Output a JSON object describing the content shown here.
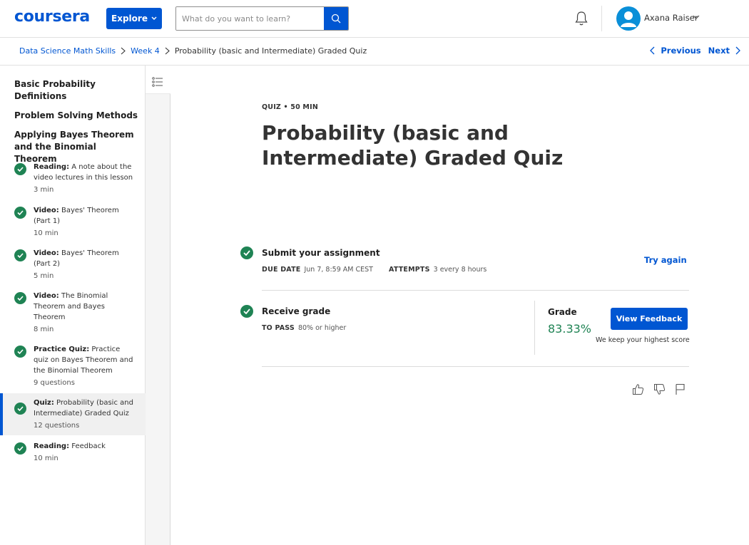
{
  "header": {
    "logo": "coursera",
    "explore_label": "Explore",
    "search_placeholder": "What do you want to learn?",
    "user_name": "Axana Raiser"
  },
  "breadcrumb": {
    "items": [
      "Data Science Math Skills",
      "Week 4",
      "Probability (basic and Intermediate) Graded Quiz"
    ],
    "previous_label": "Previous",
    "next_label": "Next"
  },
  "sidebar": {
    "sections": [
      "Basic Probability Definitions",
      "Problem Solving Methods",
      "Applying Bayes Theorem and the Binomial Theorem"
    ],
    "items": [
      {
        "type": "Reading:",
        "title": " A note about the video lectures in this lesson",
        "meta": "3 min"
      },
      {
        "type": "Video:",
        "title": " Bayes' Theorem (Part 1)",
        "meta": "10 min"
      },
      {
        "type": "Video:",
        "title": " Bayes' Theorem (Part 2)",
        "meta": "5 min"
      },
      {
        "type": "Video:",
        "title": " The Binomial Theorem and Bayes Theorem",
        "meta": "8 min"
      },
      {
        "type": "Practice Quiz:",
        "title": " Practice quiz on Bayes Theorem and the Binomial Theorem",
        "meta": "9 questions"
      },
      {
        "type": "Quiz:",
        "title": " Probability (basic and Intermediate) Graded Quiz",
        "meta": "12 questions"
      },
      {
        "type": "Reading:",
        "title": " Feedback",
        "meta": "10 min"
      }
    ]
  },
  "main": {
    "kicker": "QUIZ • 50 MIN",
    "title": "Probability (basic and Intermediate) Graded Quiz",
    "submit": {
      "title": "Submit your assignment",
      "due_label": "DUE DATE",
      "due_value": "Jun 7, 8:59 AM CEST",
      "attempts_label": "ATTEMPTS",
      "attempts_value": "3 every 8 hours",
      "try_again": "Try again"
    },
    "grade": {
      "title": "Receive grade",
      "pass_label": "TO PASS",
      "pass_value": "80% or higher",
      "grade_label": "Grade",
      "grade_value": "83.33%",
      "feedback_button": "View Feedback",
      "note": "We keep your highest score"
    }
  },
  "colors": {
    "accent": "#0056d2",
    "success": "#1f8354"
  }
}
